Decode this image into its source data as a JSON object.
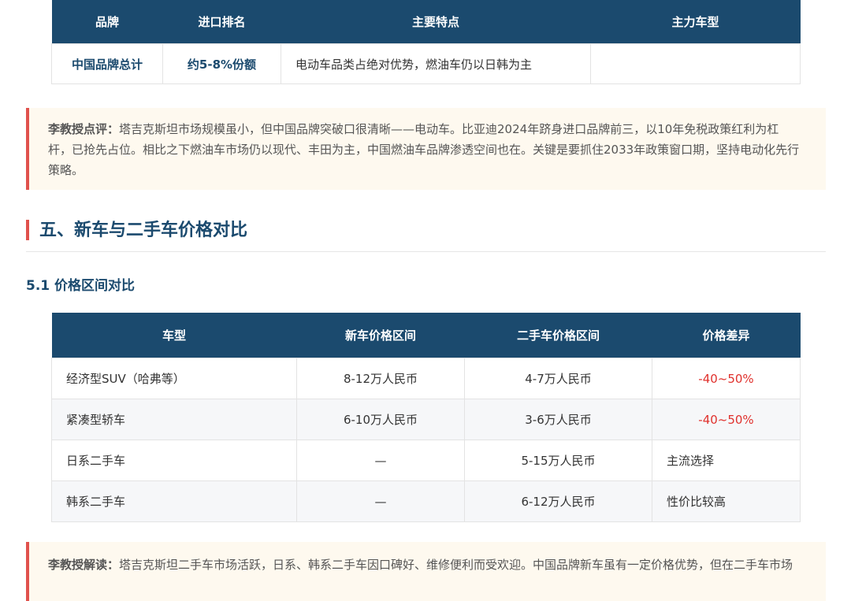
{
  "brand_table": {
    "headers": [
      "品牌",
      "进口排名",
      "主要特点",
      "主力车型"
    ],
    "rows": [
      [
        "中国品牌总计",
        "约5-8%份额",
        "电动车品类占绝对优势，燃油车仍以日韩为主",
        ""
      ]
    ]
  },
  "note1": {
    "lead": "李教授点评：",
    "text": "塔吉克斯坦市场规模虽小，但中国品牌突破口很清晰——电动车。比亚迪2024年跻身进口品牌前三，以10年免税政策红利为杠杆，已抢先占位。相比之下燃油车市场仍以现代、丰田为主，中国燃油车品牌渗透空间也在。关键是要抓住2033年政策窗口期，坚持电动化先行策略。"
  },
  "section": {
    "title": "五、新车与二手车价格对比",
    "subtitle": "5.1 价格区间对比"
  },
  "price_table": {
    "headers": [
      "车型",
      "新车价格区间",
      "二手车价格区间",
      "价格差异"
    ],
    "rows": [
      [
        "经济型SUV（哈弗等）",
        "8-12万人民币",
        "4-7万人民币",
        "-40~50%"
      ],
      [
        "紧凑型轿车",
        "6-10万人民币",
        "3-6万人民币",
        "-40~50%"
      ],
      [
        "日系二手车",
        "—",
        "5-15万人民币",
        "主流选择"
      ],
      [
        "韩系二手车",
        "—",
        "6-12万人民币",
        "性价比较高"
      ]
    ]
  },
  "note2": {
    "lead": "李教授解读：",
    "text": "塔吉克斯坦二手车市场活跃，日系、韩系二手车因口碑好、维修便利而受欢迎。中国品牌新车虽有一定价格优势，但在二手车市场"
  },
  "colors": {
    "header_bg": "#1b4a6e",
    "accent_red": "#e0514c",
    "negative_red": "#e0312d",
    "note_bg": "#fef9ef"
  }
}
